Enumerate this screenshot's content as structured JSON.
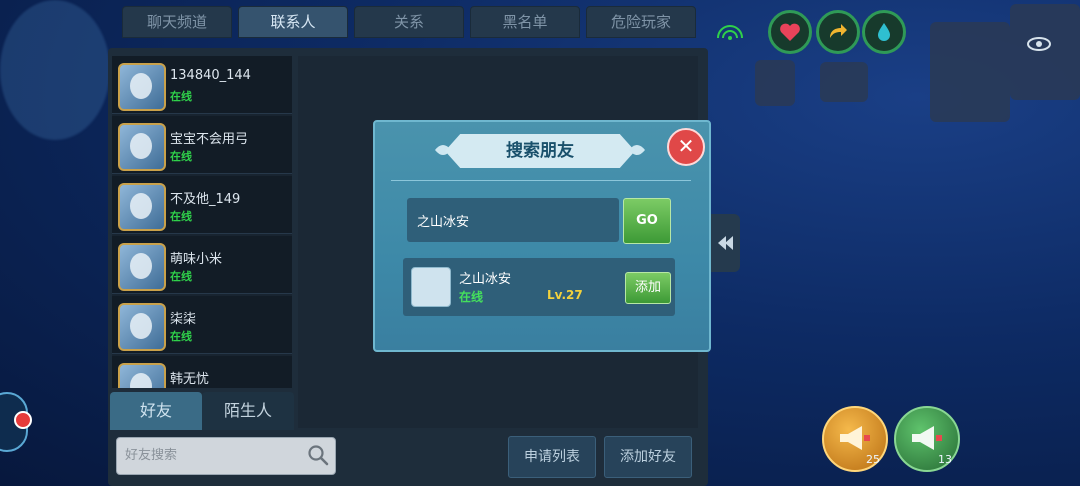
{
  "tabs": [
    {
      "label": "聊天频道",
      "active": false
    },
    {
      "label": "联系人",
      "active": true
    },
    {
      "label": "关系",
      "active": false
    },
    {
      "label": "黑名单",
      "active": false
    },
    {
      "label": "危险玩家",
      "active": false
    }
  ],
  "contacts": [
    {
      "name": "134840_144",
      "status": "在线"
    },
    {
      "name": "宝宝不会用弓",
      "status": "在线"
    },
    {
      "name": "不及他_149",
      "status": "在线"
    },
    {
      "name": "萌味小米",
      "status": "在线"
    },
    {
      "name": "柒柒",
      "status": "在线"
    },
    {
      "name": "韩无忧",
      "status": ""
    }
  ],
  "bottom_tabs": {
    "friends": "好友",
    "strangers": "陌生人"
  },
  "friend_search": {
    "placeholder": "好友搜索"
  },
  "bottom_buttons": {
    "request_list": "申请列表",
    "add_friend": "添加好友"
  },
  "modal": {
    "title": "搜索朋友",
    "search_value": "之山冰安",
    "go_label": "GO",
    "result": {
      "name": "之山冰安",
      "status": "在线",
      "level": "Lv.27",
      "add_label": "添加"
    }
  },
  "horns": {
    "gold_count": "25",
    "green_count": "13"
  },
  "colors": {
    "online": "#2fd14a",
    "level": "#f2d13c",
    "close": "#e04848",
    "go": "#4fae42"
  },
  "icons": [
    "heart-icon",
    "share-icon",
    "drop-icon",
    "eye-icon",
    "signal-icon",
    "search-icon",
    "close-icon",
    "collapse-arrow-icon",
    "horn-icon"
  ]
}
